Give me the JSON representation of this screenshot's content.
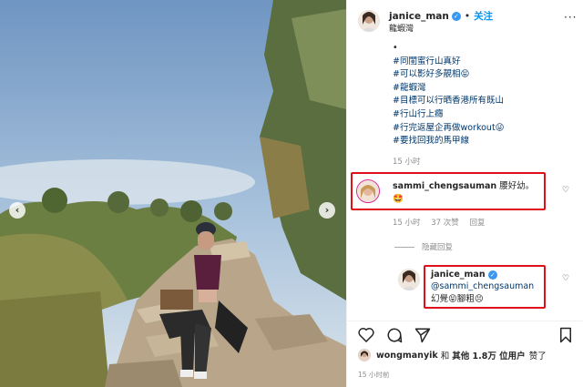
{
  "post": {
    "username": "janice_man",
    "follow_label": "关注",
    "location": "龍蝦灣",
    "caption_lines": [
      "#同閨蜜行山真好",
      "#可以影好多靚相😝",
      "#龍蝦灣",
      "#目標可以行晒香港所有既山",
      "#行山行上癮",
      "#行完返屋企再做workout😜",
      "#要找回我的馬甲線"
    ],
    "caption_bullet": "•",
    "caption_time": "15 小时"
  },
  "comments": [
    {
      "username": "sammi_chengsauman",
      "text": "腰好幼。",
      "text_line2": "🤩",
      "time": "15 小时",
      "likes": "37 次赞",
      "reply_label": "回复"
    }
  ],
  "hide_replies_label": "隐藏回复",
  "reply": {
    "username": "janice_man",
    "mention": "@sammi_chengsauman",
    "text": "幻覺😝腳粗😣"
  },
  "likes_summary": {
    "user": "wongmanyik",
    "and": "和",
    "others": "其他 1.8万 位用户",
    "liked": "赞了"
  },
  "post_time": "15 小时前",
  "icons": {
    "heart": "heart-icon",
    "comment": "comment-icon",
    "share": "share-icon",
    "save": "bookmark-icon",
    "more": "more-icon",
    "verified": "verified-badge-icon"
  },
  "colors": {
    "accent_blue": "#0095f6",
    "verified_blue": "#3897f0",
    "hashtag": "#00376b",
    "highlight_red": "#e0111a",
    "muted": "#8e8e8e"
  }
}
